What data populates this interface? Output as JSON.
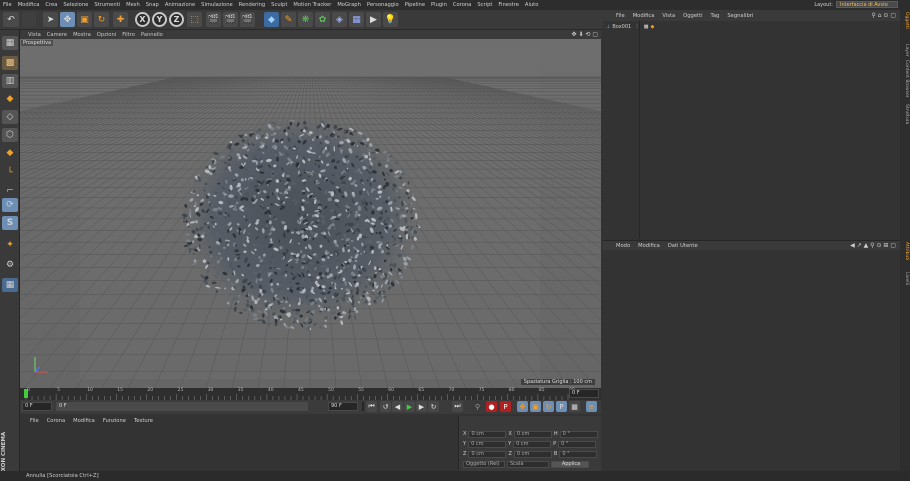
{
  "menubar": {
    "items": [
      "File",
      "Modifica",
      "Crea",
      "Selezione",
      "Strumenti",
      "Mesh",
      "Snap",
      "Animazione",
      "Simulazione",
      "Rendering",
      "Sculpt",
      "Motion Tracker",
      "MoGraph",
      "Personaggio",
      "Pipeline",
      "Plugin",
      "Corona",
      "Script",
      "Finestre",
      "Aiuto"
    ],
    "layout_label": "Layout:",
    "layout_value": "Interfaccia di Avvio"
  },
  "toolbar": {
    "axis_x": "X",
    "axis_y": "Y",
    "axis_z": "Z"
  },
  "viewport": {
    "menu": [
      "Vista",
      "Camere",
      "Mostra",
      "Opzioni",
      "Filtro",
      "Pannello"
    ],
    "camera_label": "Prospettiva",
    "grid_info": "Spaziatura Griglia : 100 cm"
  },
  "timeline": {
    "ticks": [
      "0",
      "5",
      "10",
      "15",
      "20",
      "25",
      "30",
      "35",
      "40",
      "45",
      "50",
      "55",
      "60",
      "65",
      "70",
      "75",
      "80",
      "85",
      "90"
    ],
    "frame_current": "0 F",
    "frame_start": "0 F",
    "frame_end": "90 F",
    "frame_max": "90 F",
    "frame_right": "0 F"
  },
  "material_panel": {
    "menu": [
      "File",
      "Corona",
      "Modifica",
      "Funzione",
      "Texture"
    ]
  },
  "coordinates": {
    "rows": [
      {
        "a": "X",
        "av": "0 cm",
        "b": "X",
        "bv": "0 cm",
        "c": "H",
        "cv": "0 °"
      },
      {
        "a": "Y",
        "av": "0 cm",
        "b": "Y",
        "bv": "0 cm",
        "c": "P",
        "cv": "0 °"
      },
      {
        "a": "Z",
        "av": "0 cm",
        "b": "Z",
        "bv": "0 cm",
        "c": "B",
        "cv": "0 °"
      }
    ],
    "mode_left": "Oggetto (Rel)",
    "mode_mid": "Scala",
    "apply": "Applica"
  },
  "object_manager": {
    "menu": [
      "File",
      "Modifica",
      "Vista",
      "Oggetti",
      "Tag",
      "Segnalibri"
    ],
    "objects": [
      {
        "name": "Box001"
      }
    ]
  },
  "attribute_manager": {
    "menu": [
      "Modo",
      "Modifica",
      "Dati Utente"
    ]
  },
  "side_tabs": [
    "Oggetti",
    "Layer",
    "Content Browser",
    "Struttura",
    "Attributi",
    "Livelli"
  ],
  "logo_text": "MAXON CINEMA 4D",
  "status": "Annulla [Scorciatoia Ctrl+Z]",
  "colors": {
    "accent_orange": "#f0a030",
    "accent_blue": "#6d8fb5",
    "viewport_bg": "#6b6b6b"
  }
}
